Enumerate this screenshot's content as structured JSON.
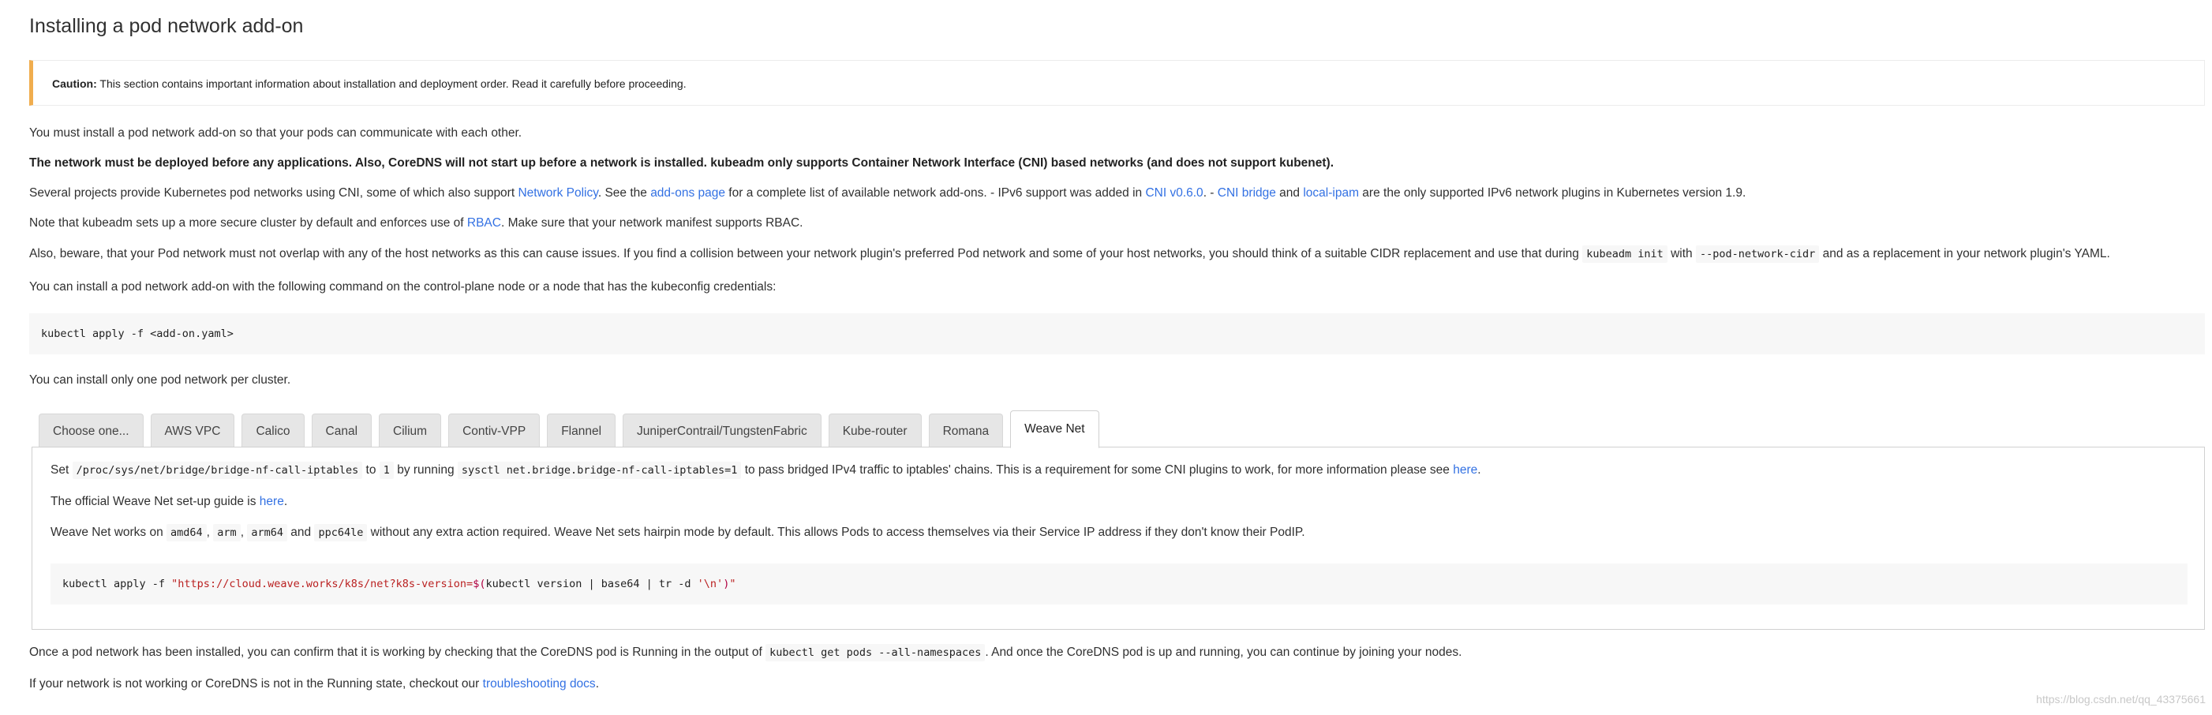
{
  "title": "Installing a pod network add-on",
  "caution": {
    "label": "Caution:",
    "text": " This section contains important information about installation and deployment order. Read it carefully before proceeding."
  },
  "para1": "You must install a pod network add-on so that your pods can communicate with each other.",
  "para2": "The network must be deployed before any applications. Also, CoreDNS will not start up before a network is installed. kubeadm only supports Container Network Interface (CNI) based networks (and does not support kubenet).",
  "para3": {
    "t1": "Several projects provide Kubernetes pod networks using CNI, some of which also support ",
    "link1": "Network Policy",
    "t2": ". See the ",
    "link2": "add-ons page",
    "t3": " for a complete list of available network add-ons. - IPv6 support was added in ",
    "link3": "CNI v0.6.0",
    "t4": ". - ",
    "link4": "CNI bridge",
    "t5": " and ",
    "link5": "local-ipam",
    "t6": " are the only supported IPv6 network plugins in Kubernetes version 1.9."
  },
  "para4": {
    "t1": "Note that kubeadm sets up a more secure cluster by default and enforces use of ",
    "link1": "RBAC",
    "t2": ". Make sure that your network manifest supports RBAC."
  },
  "para5": {
    "t1": "Also, beware, that your Pod network must not overlap with any of the host networks as this can cause issues. If you find a collision between your network plugin's preferred Pod network and some of your host networks, you should think of a suitable CIDR replacement and use that during ",
    "code1": "kubeadm init",
    "t2": " with ",
    "code2": "--pod-network-cidr",
    "t3": " and as a replacement in your network plugin's YAML."
  },
  "para6": "You can install a pod network add-on with the following command on the control-plane node or a node that has the kubeconfig credentials:",
  "code_apply": "kubectl apply -f <add-on.yaml>",
  "para7": "You can install only one pod network per cluster.",
  "tabs": [
    {
      "label": "Choose one..."
    },
    {
      "label": "AWS VPC"
    },
    {
      "label": "Calico"
    },
    {
      "label": "Canal"
    },
    {
      "label": "Cilium"
    },
    {
      "label": "Contiv-VPP"
    },
    {
      "label": "Flannel"
    },
    {
      "label": "JuniperContrail/TungstenFabric"
    },
    {
      "label": "Kube-router"
    },
    {
      "label": "Romana"
    },
    {
      "label": "Weave Net"
    }
  ],
  "active_tab": "Weave Net",
  "panel": {
    "p1": {
      "t1": "Set ",
      "code1": "/proc/sys/net/bridge/bridge-nf-call-iptables",
      "t2": " to ",
      "code2": "1",
      "t3": " by running ",
      "code3": "sysctl net.bridge.bridge-nf-call-iptables=1",
      "t4": " to pass bridged IPv4 traffic to iptables' chains. This is a requirement for some CNI plugins to work, for more information please see ",
      "link": "here",
      "t5": "."
    },
    "p2": {
      "t1": "The official Weave Net set-up guide is ",
      "link": "here",
      "t2": "."
    },
    "p3": {
      "t1": "Weave Net works on ",
      "c1": "amd64",
      "s1": ", ",
      "c2": "arm",
      "s2": ", ",
      "c3": "arm64",
      "s3": " and ",
      "c4": "ppc64le",
      "t2": " without any extra action required. Weave Net sets hairpin mode by default. This allows Pods to access themselves via their Service IP address if they don't know their PodIP."
    },
    "code": {
      "pre": "kubectl apply -f ",
      "str1": "\"https://cloud.weave.works/k8s/net?k8s-version=",
      "dollar": "$(",
      "mid": "kubectl version | base64 | tr -d ",
      "str2": "'\\n'",
      "close": ")",
      "str3": "\""
    }
  },
  "para8": {
    "t1": "Once a pod network has been installed, you can confirm that it is working by checking that the CoreDNS pod is Running in the output of ",
    "code": "kubectl get pods --all-namespaces",
    "t2": ". And once the CoreDNS pod is up and running, you can continue by joining your nodes."
  },
  "para9": {
    "t1": "If your network is not working or CoreDNS is not in the Running state, checkout our ",
    "link": "troubleshooting docs",
    "t2": "."
  },
  "watermark": "https://blog.csdn.net/qq_43375661",
  "colors": {
    "link": "#3371e3",
    "caution_border": "#f0ad4e",
    "code_bg": "#f7f7f7"
  }
}
